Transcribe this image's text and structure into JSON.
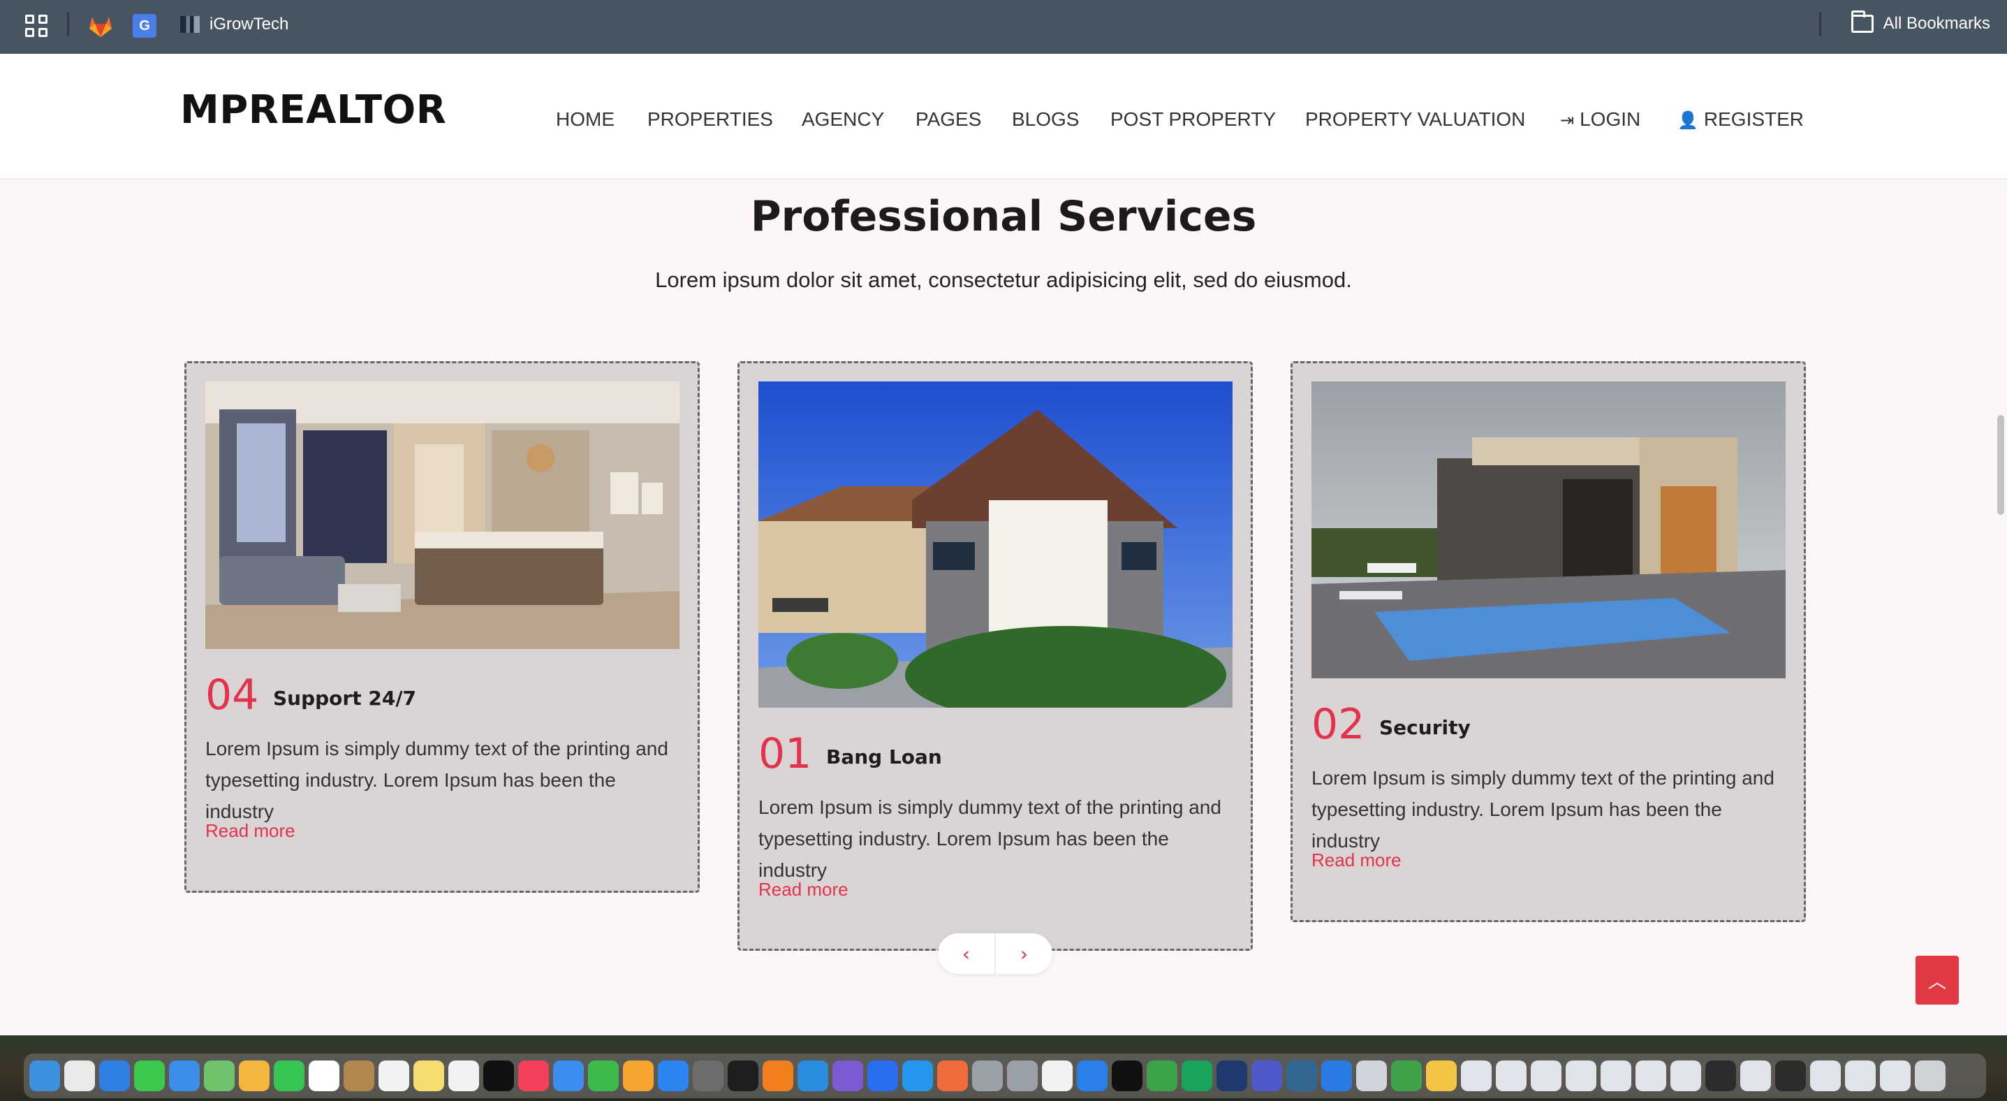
{
  "bookmarks": {
    "items": [
      {
        "label": "iGrowTech"
      }
    ],
    "all_bookmarks": "All Bookmarks"
  },
  "site": {
    "logo": "MPREALTOR",
    "nav": [
      {
        "label": "HOME"
      },
      {
        "label": "PROPERTIES"
      },
      {
        "label": "AGENCY"
      },
      {
        "label": "PAGES"
      },
      {
        "label": "BLOGS"
      },
      {
        "label": "POST PROPERTY"
      },
      {
        "label": "PROPERTY VALUATION"
      },
      {
        "label": "LOGIN",
        "icon": "sign-in-icon"
      },
      {
        "label": "REGISTER",
        "icon": "user-icon"
      }
    ]
  },
  "services": {
    "title": "Professional Services",
    "subtitle": "Lorem ipsum dolor sit amet, consectetur adipisicing elit, sed do eiusmod.",
    "cards": [
      {
        "number": "04",
        "title": "Support 24/7",
        "text": "Lorem Ipsum is simply dummy text of the printing and typesetting industry. Lorem Ipsum has been the industry",
        "link": "Read more",
        "image": "bedroom-interior-photo"
      },
      {
        "number": "01",
        "title": "Bang Loan",
        "text": "Lorem Ipsum is simply dummy text of the printing and typesetting industry. Lorem Ipsum has been the industry",
        "link": "Read more",
        "image": "hotel-building-photo"
      },
      {
        "number": "02",
        "title": "Security",
        "text": "Lorem Ipsum is simply dummy text of the printing and typesetting industry. Lorem Ipsum has been the industry",
        "link": "Read more",
        "image": "modern-house-pool-photo"
      }
    ],
    "prev_icon": "chevron-left-icon",
    "next_icon": "chevron-right-icon"
  },
  "scroll_top_icon": "chevron-up-icon",
  "colors": {
    "accent": "#e2334d",
    "page_bg": "#fcf7f6",
    "card_bg": "#dbd4d4",
    "bookmarks_bar": "#475563"
  }
}
